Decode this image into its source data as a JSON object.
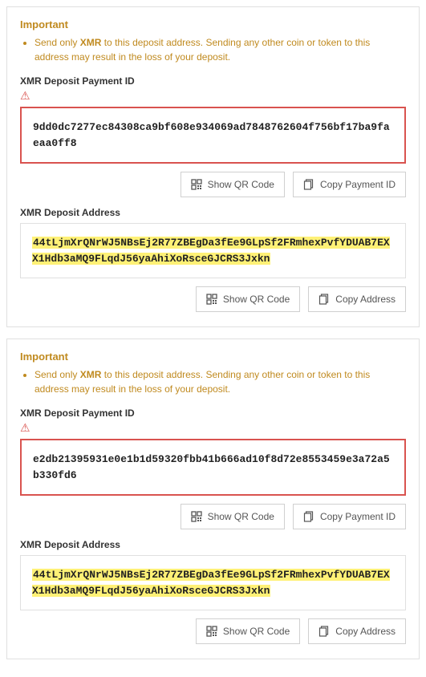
{
  "panels": [
    {
      "important_heading": "Important",
      "warning_prefix": "Send only ",
      "warning_coin": "XMR",
      "warning_suffix": " to this deposit address. Sending any other coin or token to this address may result in the loss of your deposit.",
      "payment_id_label": "XMR Deposit Payment ID",
      "payment_id": "9dd0dc7277ec84308ca9bf608e934069ad7848762604f756bf17ba9faeaa0ff8",
      "qr_button": "Show QR Code",
      "copy_id_button": "Copy Payment ID",
      "address_label": "XMR Deposit Address",
      "address": "44tLjmXrQNrWJ5NBsEj2R77ZBEgDa3fEe9GLpSf2FRmhexPvfYDUAB7EXX1Hdb3aMQ9FLqdJ56yaAhiXoRsceGJCRS3Jxkn",
      "copy_addr_button": "Copy Address"
    },
    {
      "important_heading": "Important",
      "warning_prefix": "Send only ",
      "warning_coin": "XMR",
      "warning_suffix": " to this deposit address. Sending any other coin or token to this address may result in the loss of your deposit.",
      "payment_id_label": "XMR Deposit Payment ID",
      "payment_id": "e2db21395931e0e1b1d59320fbb41b666ad10f8d72e8553459e3a72a5b330fd6",
      "qr_button": "Show QR Code",
      "copy_id_button": "Copy Payment ID",
      "address_label": "XMR Deposit Address",
      "address": "44tLjmXrQNrWJ5NBsEj2R77ZBEgDa3fEe9GLpSf2FRmhexPvfYDUAB7EXX1Hdb3aMQ9FLqdJ56yaAhiXoRsceGJCRS3Jxkn",
      "copy_addr_button": "Copy Address"
    }
  ]
}
